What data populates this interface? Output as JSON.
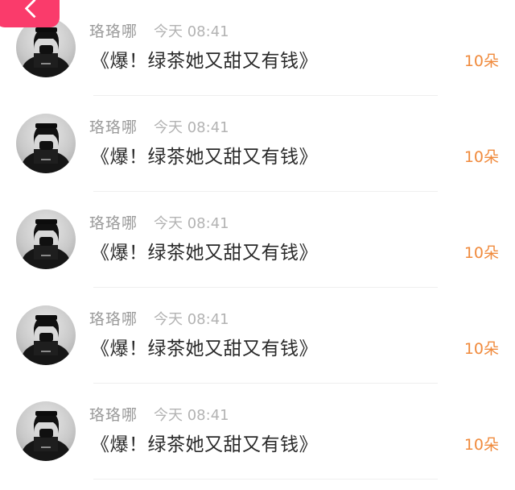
{
  "corner_button": {
    "icon": "chevron-left-icon",
    "color": "#fa3b6b"
  },
  "comments": [
    {
      "name": "珞珞哪",
      "time": "今天 08:41",
      "title": "《爆！绿茶她又甜又有钱》",
      "gift": "10朵"
    },
    {
      "name": "珞珞哪",
      "time": "今天 08:41",
      "title": "《爆！绿茶她又甜又有钱》",
      "gift": "10朵"
    },
    {
      "name": "珞珞哪",
      "time": "今天 08:41",
      "title": "《爆！绿茶她又甜又有钱》",
      "gift": "10朵"
    },
    {
      "name": "珞珞哪",
      "time": "今天 08:41",
      "title": "《爆！绿茶她又甜又有钱》",
      "gift": "10朵"
    },
    {
      "name": "珞珞哪",
      "time": "今天 08:41",
      "title": "《爆！绿茶她又甜又有钱》",
      "gift": "10朵"
    }
  ],
  "colors": {
    "accent": "#fa3b6b",
    "gift": "#f08a3c",
    "name": "#9a9a9a",
    "time": "#b3b3b3",
    "title": "#2a2a2a"
  }
}
